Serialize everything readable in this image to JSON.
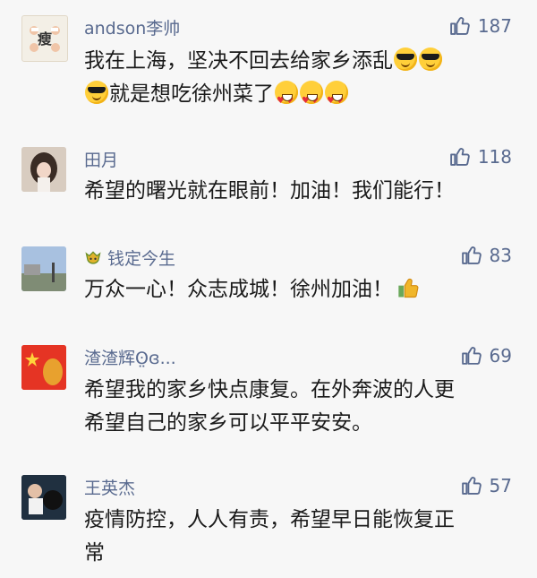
{
  "comments": [
    {
      "username": "andson李帅",
      "likes": "187",
      "line1": "我在上海，坚决不回去给家乡添乱",
      "line2": "就是想吃徐州菜了",
      "avatar_text": "瘦"
    },
    {
      "username": "田月",
      "likes": "118",
      "line1": "希望的曙光就在眼前！加油！我们能行！"
    },
    {
      "username": "钱定今生",
      "likes": "83",
      "line1": "万众一心！众志成城！徐州加油！"
    },
    {
      "username": "渣渣辉ʘ̤ɞ...",
      "likes": "69",
      "line1": "希望我的家乡快点康复。在外奔波的人更",
      "line2": "希望自己的家乡可以平平安安。"
    },
    {
      "username": "王英杰",
      "likes": "57",
      "line1": "疫情防控，人人有责，希望早日能恢复正",
      "line2": "常"
    }
  ],
  "colors": {
    "username": "#596a8f",
    "background": "#f7f7f7"
  }
}
